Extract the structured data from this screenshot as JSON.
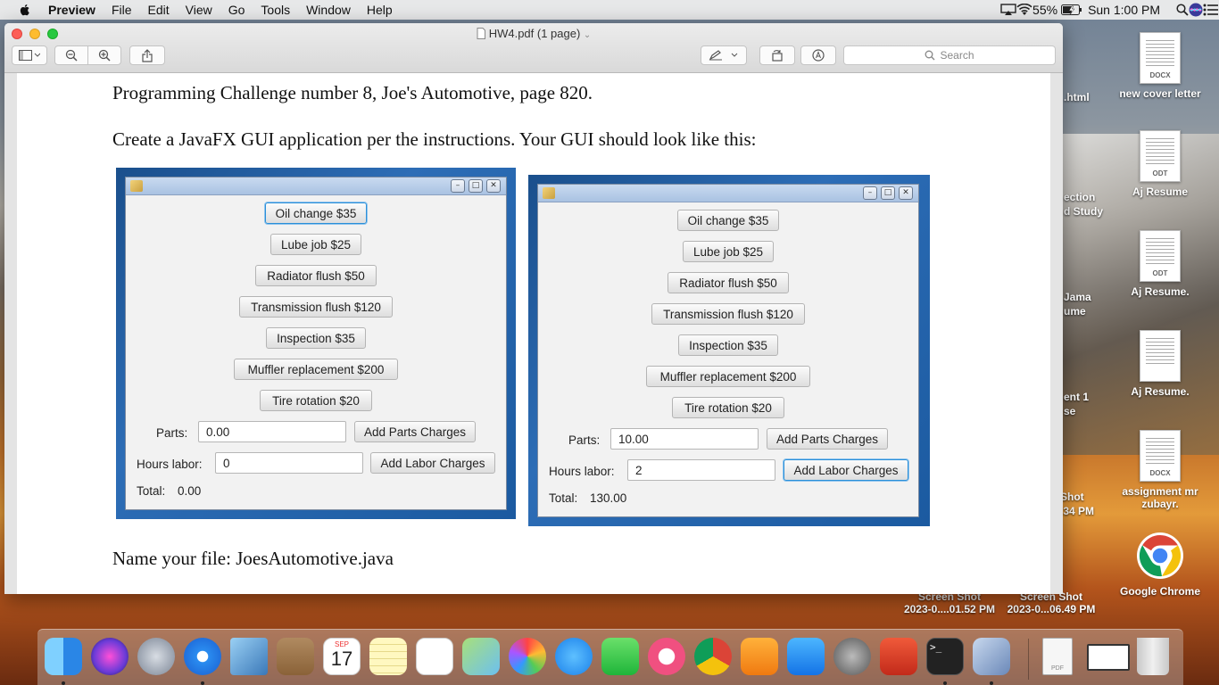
{
  "menubar": {
    "app_name": "Preview",
    "items": [
      "File",
      "Edit",
      "View",
      "Go",
      "Tools",
      "Window",
      "Help"
    ],
    "battery": "55%",
    "clock": "Sun 1:00 PM"
  },
  "window": {
    "title": "HW4.pdf (1 page)",
    "search_placeholder": "Search"
  },
  "document": {
    "line1": "Programming Challenge number 8, Joe's Automotive, page 820.",
    "line2": "Create a JavaFX GUI application per the instructions.  Your GUI should look like this:",
    "line3": "Name your file:  JoesAutomotive.java"
  },
  "gui_left": {
    "buttons": [
      "Oil change $35",
      "Lube job $25",
      "Radiator flush $50",
      "Transmission flush $120",
      "Inspection $35",
      "Muffler replacement $200",
      "Tire rotation $20"
    ],
    "parts_label": "Parts:",
    "parts_value": "0.00",
    "add_parts": "Add Parts Charges",
    "hours_label": "Hours labor:",
    "hours_value": "0",
    "add_labor": "Add Labor Charges",
    "total_label": "Total:",
    "total_value": "0.00"
  },
  "gui_right": {
    "buttons": [
      "Oil change $35",
      "Lube job $25",
      "Radiator flush $50",
      "Transmission flush $120",
      "Inspection $35",
      "Muffler replacement $200",
      "Tire rotation $20"
    ],
    "parts_label": "Parts:",
    "parts_value": "10.00",
    "add_parts": "Add Parts Charges",
    "hours_label": "Hours labor:",
    "hours_value": "2",
    "add_labor": "Add Labor Charges",
    "total_label": "Total:",
    "total_value": "130.00"
  },
  "desktop": {
    "icons": [
      {
        "label": "new cover letter",
        "type": "DOCX"
      },
      {
        "label": "Aj Resume",
        "type": "ODT"
      },
      {
        "label": "Aj Resume.",
        "type": "ODT"
      },
      {
        "label": "Aj Resume.",
        "type": ""
      },
      {
        "label": "assignment mr zubayr.",
        "type": "DOCX"
      },
      {
        "label": "Google Chrome",
        "type": ""
      }
    ],
    "partials": [
      ".html",
      "ection",
      "d Study",
      "Jama",
      "ume",
      "ent 1",
      "se",
      "Shot",
      ".34 PM"
    ],
    "screenshots": [
      {
        "line1": "Screen Shot",
        "line2": "2023-0....01.52 PM"
      },
      {
        "line1": "Screen Shot",
        "line2": "2023-0...06.49 PM"
      }
    ]
  },
  "dock": {
    "calendar_month": "SEP",
    "calendar_day": "17",
    "pdf_label": "PDF"
  }
}
